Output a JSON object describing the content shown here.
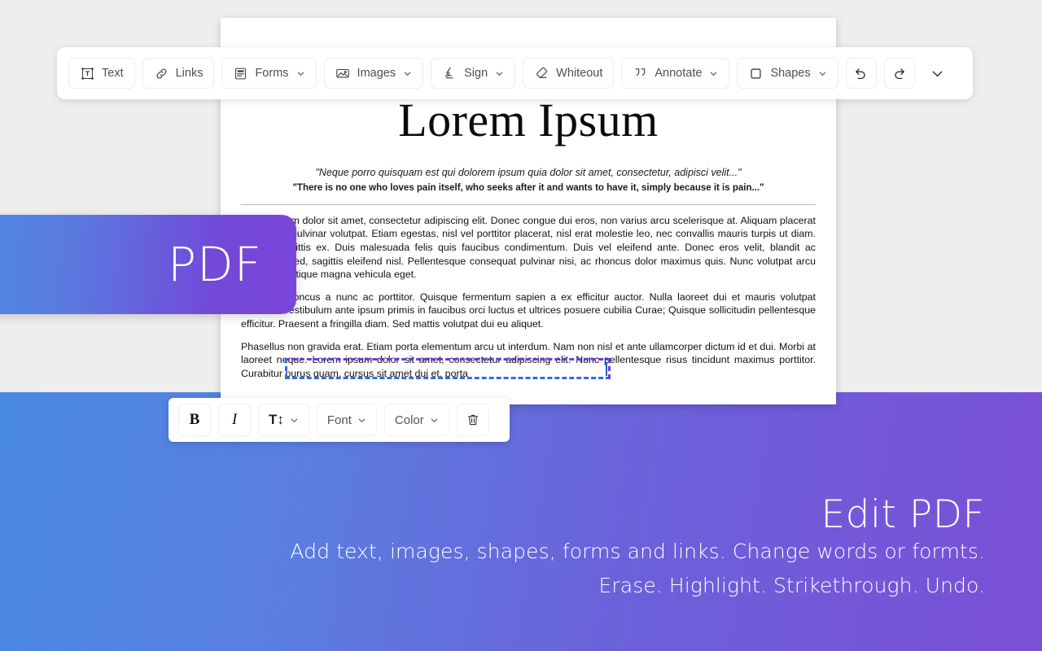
{
  "background": {
    "top_color": "#eeeeee",
    "gradient_from": "#4889e3",
    "gradient_to": "#7b4fd6"
  },
  "toolbar": {
    "buttons": [
      {
        "label": "Text",
        "icon": "text-box-icon",
        "has_caret": false
      },
      {
        "label": "Links",
        "icon": "link-icon",
        "has_caret": false
      },
      {
        "label": "Forms",
        "icon": "form-icon",
        "has_caret": true
      },
      {
        "label": "Images",
        "icon": "image-icon",
        "has_caret": true
      },
      {
        "label": "Sign",
        "icon": "signature-icon",
        "has_caret": true
      },
      {
        "label": "Whiteout",
        "icon": "eraser-icon",
        "has_caret": false
      },
      {
        "label": "Annotate",
        "icon": "quote-icon",
        "has_caret": true
      },
      {
        "label": "Shapes",
        "icon": "square-icon",
        "has_caret": true
      }
    ],
    "undo": "undo-icon",
    "redo": "redo-icon",
    "collapse": "chevron-down-icon"
  },
  "format_toolbar": {
    "bold_label": "B",
    "italic_label": "I",
    "size_label": "T↕",
    "font_label": "Font",
    "color_label": "Color",
    "delete_icon": "trash-icon"
  },
  "document": {
    "title": "Lorem Ipsum",
    "quote_latin": "\"Neque porro quisquam est qui dolorem ipsum quia dolor sit amet, consectetur, adipisci velit...\"",
    "quote_english": "\"There is no one who loves pain itself, who seeks after it and wants to have it, simply because it is pain...\"",
    "paragraphs": [
      "Lorem ipsum dolor sit amet, consectetur adipiscing elit. Donec congue dui eros, non varius arcu scelerisque at. Aliquam placerat metus sed pulvinar volutpat. Etiam egestas, nisl vel porttitor placerat, nisl erat molestie leo, nec convallis mauris turpis ut diam. Duis in sagittis ex. Duis malesuada felis quis faucibus condimentum. Duis vel eleifend ante. Donec eros velit, blandit ac bibendum sed, sagittis eleifend nisl. Pellentesque consequat pulvinar nisi, ac rhoncus dolor maximus quis. Nunc volutpat arcu velis, vel tristique magna vehicula eget.",
      "Vivamus rhoncus a nunc ac porttitor. Quisque fermentum sapien a ex efficitur auctor. Nulla laoreet dui et mauris volutpat rhoncus. Vestibulum ante ipsum primis in faucibus orci luctus et ultrices posuere cubilia Curae; Quisque sollicitudin pellentesque efficitur. Praesent a fringilla diam. Sed mattis volutpat dui eu aliquet.",
      "Phasellus non gravida erat. Etiam porta elementum arcu ut interdum. Nam non nisl et ante ullamcorper dictum id et dui. Morbi at laoreet neque. Lorem ipsum dolor sit amet, consectetur adipiscing elit. Nunc pellentesque risus tincidunt maximus porttitor. Curabitur purus quam, cursus sit amet dui et, porta"
    ]
  },
  "selection": {
    "dash_color_top": "#6d3fd1",
    "dash_color_bottom": "#2f6fe0",
    "caret_color": "#2558c8"
  },
  "badge": {
    "label": "PDF"
  },
  "promo": {
    "title": "Edit PDF",
    "line1": "Add text, images, shapes, forms and links. Change words or formts.",
    "line2": "Erase. Highlight. Strikethrough. Undo."
  }
}
